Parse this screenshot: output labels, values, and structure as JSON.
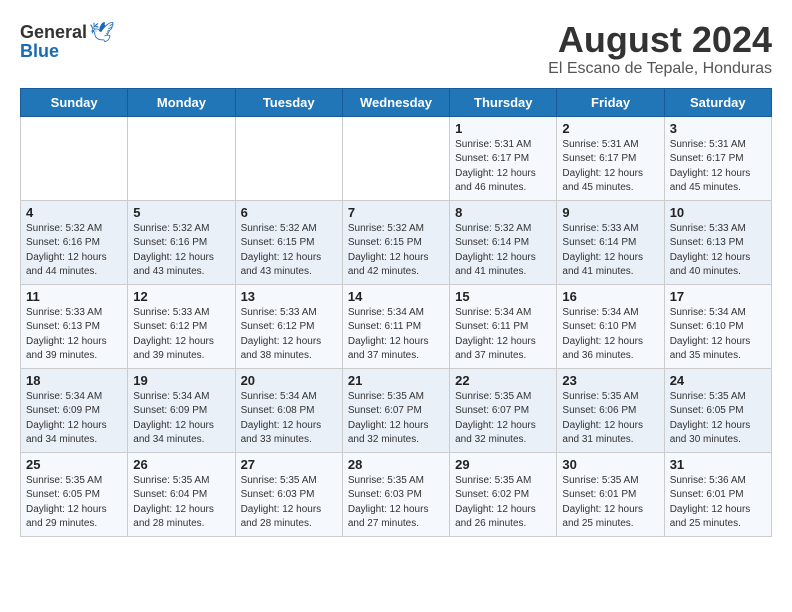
{
  "header": {
    "logo_general": "General",
    "logo_blue": "Blue",
    "main_title": "August 2024",
    "sub_title": "El Escano de Tepale, Honduras"
  },
  "weekdays": [
    "Sunday",
    "Monday",
    "Tuesday",
    "Wednesday",
    "Thursday",
    "Friday",
    "Saturday"
  ],
  "weeks": [
    [
      {
        "day": "",
        "info": ""
      },
      {
        "day": "",
        "info": ""
      },
      {
        "day": "",
        "info": ""
      },
      {
        "day": "",
        "info": ""
      },
      {
        "day": "1",
        "info": "Sunrise: 5:31 AM\nSunset: 6:17 PM\nDaylight: 12 hours\nand 46 minutes."
      },
      {
        "day": "2",
        "info": "Sunrise: 5:31 AM\nSunset: 6:17 PM\nDaylight: 12 hours\nand 45 minutes."
      },
      {
        "day": "3",
        "info": "Sunrise: 5:31 AM\nSunset: 6:17 PM\nDaylight: 12 hours\nand 45 minutes."
      }
    ],
    [
      {
        "day": "4",
        "info": "Sunrise: 5:32 AM\nSunset: 6:16 PM\nDaylight: 12 hours\nand 44 minutes."
      },
      {
        "day": "5",
        "info": "Sunrise: 5:32 AM\nSunset: 6:16 PM\nDaylight: 12 hours\nand 43 minutes."
      },
      {
        "day": "6",
        "info": "Sunrise: 5:32 AM\nSunset: 6:15 PM\nDaylight: 12 hours\nand 43 minutes."
      },
      {
        "day": "7",
        "info": "Sunrise: 5:32 AM\nSunset: 6:15 PM\nDaylight: 12 hours\nand 42 minutes."
      },
      {
        "day": "8",
        "info": "Sunrise: 5:32 AM\nSunset: 6:14 PM\nDaylight: 12 hours\nand 41 minutes."
      },
      {
        "day": "9",
        "info": "Sunrise: 5:33 AM\nSunset: 6:14 PM\nDaylight: 12 hours\nand 41 minutes."
      },
      {
        "day": "10",
        "info": "Sunrise: 5:33 AM\nSunset: 6:13 PM\nDaylight: 12 hours\nand 40 minutes."
      }
    ],
    [
      {
        "day": "11",
        "info": "Sunrise: 5:33 AM\nSunset: 6:13 PM\nDaylight: 12 hours\nand 39 minutes."
      },
      {
        "day": "12",
        "info": "Sunrise: 5:33 AM\nSunset: 6:12 PM\nDaylight: 12 hours\nand 39 minutes."
      },
      {
        "day": "13",
        "info": "Sunrise: 5:33 AM\nSunset: 6:12 PM\nDaylight: 12 hours\nand 38 minutes."
      },
      {
        "day": "14",
        "info": "Sunrise: 5:34 AM\nSunset: 6:11 PM\nDaylight: 12 hours\nand 37 minutes."
      },
      {
        "day": "15",
        "info": "Sunrise: 5:34 AM\nSunset: 6:11 PM\nDaylight: 12 hours\nand 37 minutes."
      },
      {
        "day": "16",
        "info": "Sunrise: 5:34 AM\nSunset: 6:10 PM\nDaylight: 12 hours\nand 36 minutes."
      },
      {
        "day": "17",
        "info": "Sunrise: 5:34 AM\nSunset: 6:10 PM\nDaylight: 12 hours\nand 35 minutes."
      }
    ],
    [
      {
        "day": "18",
        "info": "Sunrise: 5:34 AM\nSunset: 6:09 PM\nDaylight: 12 hours\nand 34 minutes."
      },
      {
        "day": "19",
        "info": "Sunrise: 5:34 AM\nSunset: 6:09 PM\nDaylight: 12 hours\nand 34 minutes."
      },
      {
        "day": "20",
        "info": "Sunrise: 5:34 AM\nSunset: 6:08 PM\nDaylight: 12 hours\nand 33 minutes."
      },
      {
        "day": "21",
        "info": "Sunrise: 5:35 AM\nSunset: 6:07 PM\nDaylight: 12 hours\nand 32 minutes."
      },
      {
        "day": "22",
        "info": "Sunrise: 5:35 AM\nSunset: 6:07 PM\nDaylight: 12 hours\nand 32 minutes."
      },
      {
        "day": "23",
        "info": "Sunrise: 5:35 AM\nSunset: 6:06 PM\nDaylight: 12 hours\nand 31 minutes."
      },
      {
        "day": "24",
        "info": "Sunrise: 5:35 AM\nSunset: 6:05 PM\nDaylight: 12 hours\nand 30 minutes."
      }
    ],
    [
      {
        "day": "25",
        "info": "Sunrise: 5:35 AM\nSunset: 6:05 PM\nDaylight: 12 hours\nand 29 minutes."
      },
      {
        "day": "26",
        "info": "Sunrise: 5:35 AM\nSunset: 6:04 PM\nDaylight: 12 hours\nand 28 minutes."
      },
      {
        "day": "27",
        "info": "Sunrise: 5:35 AM\nSunset: 6:03 PM\nDaylight: 12 hours\nand 28 minutes."
      },
      {
        "day": "28",
        "info": "Sunrise: 5:35 AM\nSunset: 6:03 PM\nDaylight: 12 hours\nand 27 minutes."
      },
      {
        "day": "29",
        "info": "Sunrise: 5:35 AM\nSunset: 6:02 PM\nDaylight: 12 hours\nand 26 minutes."
      },
      {
        "day": "30",
        "info": "Sunrise: 5:35 AM\nSunset: 6:01 PM\nDaylight: 12 hours\nand 25 minutes."
      },
      {
        "day": "31",
        "info": "Sunrise: 5:36 AM\nSunset: 6:01 PM\nDaylight: 12 hours\nand 25 minutes."
      }
    ]
  ]
}
